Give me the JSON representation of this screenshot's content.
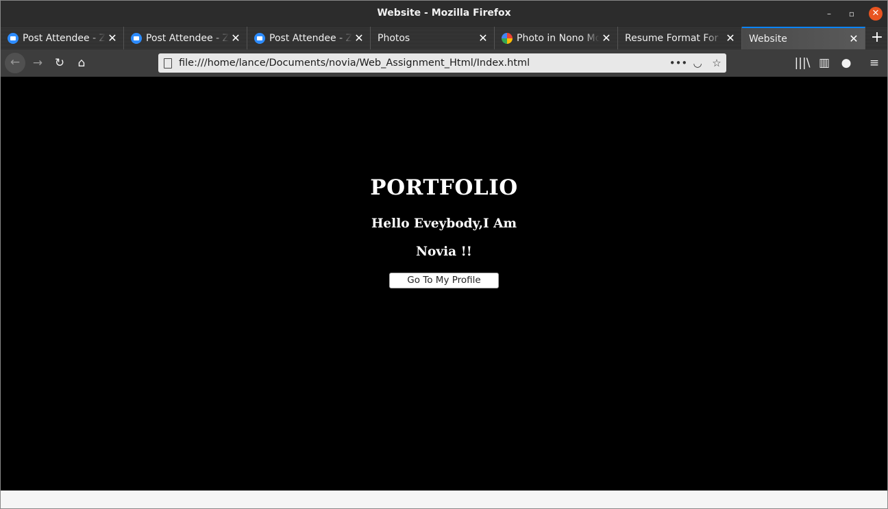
{
  "window": {
    "title": "Website - Mozilla Firefox",
    "controls": {
      "minimize": "–",
      "maximize": "▫",
      "close": "✕"
    }
  },
  "tabs": [
    {
      "label": "Post Attendee - Zoom",
      "icon": "zoom-icon",
      "close": "✕"
    },
    {
      "label": "Post Attendee - Zoom",
      "icon": "zoom-icon",
      "close": "✕"
    },
    {
      "label": "Post Attendee - Zoom",
      "icon": "zoom-icon",
      "close": "✕"
    },
    {
      "label": "Photos",
      "icon": "",
      "close": "✕"
    },
    {
      "label": "Photo in Nono Mo",
      "icon": "google-photos-icon",
      "close": "✕"
    },
    {
      "label": "Resume Format For",
      "icon": "",
      "close": "✕"
    },
    {
      "label": "Website",
      "icon": "",
      "close": "✕",
      "active": true
    }
  ],
  "new_tab": "+",
  "nav": {
    "back": "←",
    "forward": "→",
    "reload": "↻",
    "home": "⌂",
    "url": "file:///home/lance/Documents/novia/Web_Assignment_Html/Index.html",
    "page_actions": "•••",
    "pocket": "◡",
    "bookmark": "☆",
    "library": "|||\\",
    "sidebar": "▥",
    "account": "●",
    "menu": "≡"
  },
  "page": {
    "heading": "PORTFOLIO",
    "greeting_line1": "Hello Eveybody,I Am",
    "greeting_line2": "Novia !!",
    "profile_button": "Go To My Profile"
  },
  "colors": {
    "titlebar": "#2c2c2c",
    "close_button": "#e95420",
    "active_tab_accent": "#0a84ff",
    "page_background": "#000000"
  }
}
